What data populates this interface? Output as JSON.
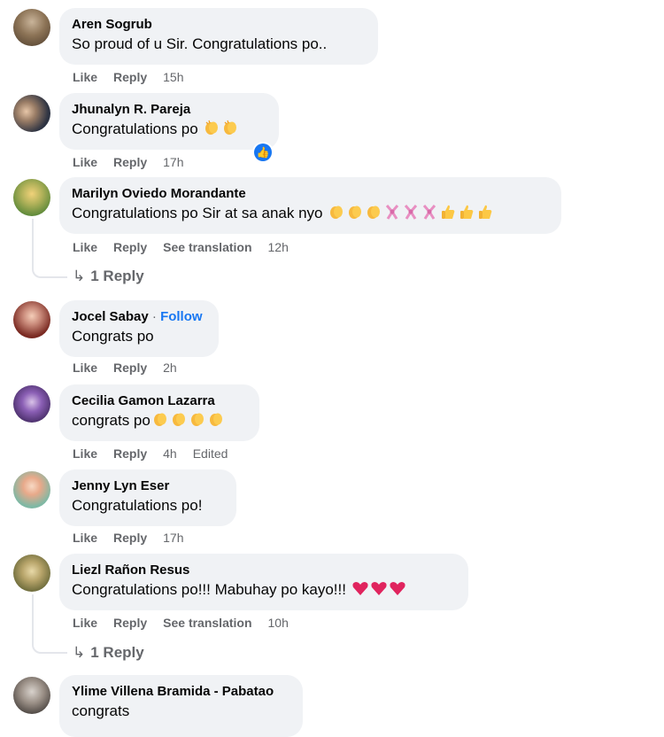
{
  "colors": {
    "bubble": "#f0f2f5",
    "meta": "#65676b",
    "follow": "#1877f2",
    "reaction": "#1877f2"
  },
  "actions": {
    "like": "Like",
    "reply": "Reply",
    "see_translation": "See translation"
  },
  "comments": [
    {
      "name": "Aren Sogrub",
      "text": "So proud of u Sir. Congratulations po..",
      "time": "15h"
    },
    {
      "name": "Jhunalyn R. Pareja",
      "text": "Congratulations po",
      "emojis": [
        "clapping-hands",
        "clapping-hands"
      ],
      "reaction": "like-icon",
      "time": "17h"
    },
    {
      "name": "Marilyn Oviedo Morandante",
      "text": "Congratulations po Sir at sa anak nyo",
      "emojis": [
        "clapping-hands",
        "clapping-hands",
        "clapping-hands",
        "ribbon",
        "ribbon",
        "ribbon",
        "thumbs-up",
        "thumbs-up",
        "thumbs-up"
      ],
      "time": "12h",
      "reply_count": "1 Reply"
    },
    {
      "name": "Jocel Sabay",
      "follow": "Follow",
      "text": "Congrats po",
      "time": "2h"
    },
    {
      "name": "Cecilia Gamon Lazarra",
      "text": "congrats po",
      "emojis": [
        "clapping-hands",
        "clapping-hands",
        "clapping-hands",
        "clapping-hands"
      ],
      "time": "4h",
      "edited": "Edited"
    },
    {
      "name": "Jenny Lyn Eser",
      "text": "Congratulations po!",
      "time": "17h"
    },
    {
      "name": "Liezl Rañon Resus",
      "text": "Congratulations po!!! Mabuhay po kayo!!!",
      "emojis": [
        "red-heart",
        "red-heart",
        "red-heart"
      ],
      "time": "10h",
      "reply_count": "1 Reply"
    },
    {
      "name": "Ylime Villena Bramida - Pabatao",
      "text": "congrats"
    }
  ]
}
